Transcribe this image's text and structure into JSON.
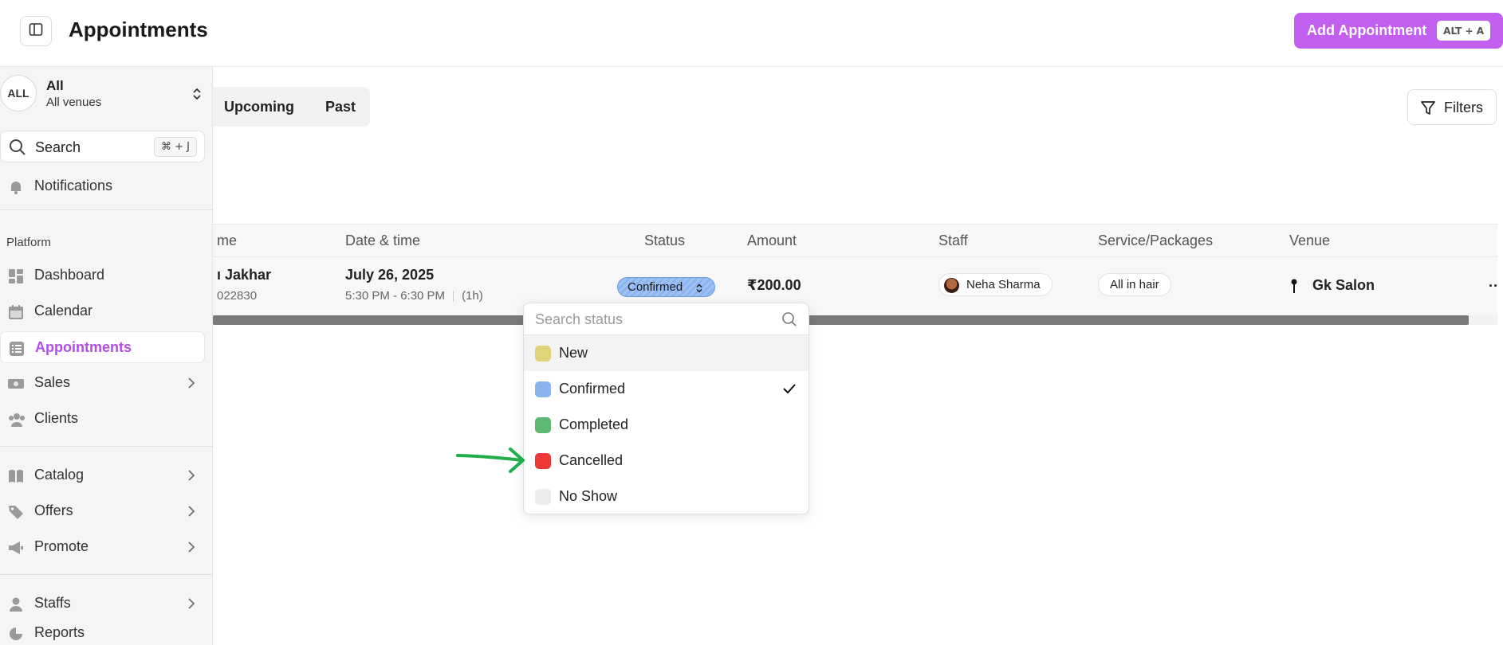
{
  "header": {
    "title": "Appointments",
    "add_button_label": "Add Appointment",
    "add_button_shortcut": "ALT + A",
    "accent_color": "#c25ef0"
  },
  "sidebar": {
    "venue": {
      "avatar": "ALL",
      "name": "All",
      "sub": "All venues"
    },
    "search": {
      "label": "Search",
      "shortcut": "⌘ + J"
    },
    "notifications": "Notifications",
    "section_label": "Platform",
    "items": [
      {
        "label": "Dashboard",
        "icon": "dashboard-icon"
      },
      {
        "label": "Calendar",
        "icon": "calendar-icon"
      },
      {
        "label": "Appointments",
        "icon": "list-icon",
        "active": true
      },
      {
        "label": "Sales",
        "icon": "money-icon",
        "has_children": true
      },
      {
        "label": "Clients",
        "icon": "users-icon"
      },
      {
        "label": "Catalog",
        "icon": "book-icon",
        "has_children": true
      },
      {
        "label": "Offers",
        "icon": "tag-icon",
        "has_children": true
      },
      {
        "label": "Promote",
        "icon": "megaphone-icon",
        "has_children": true
      },
      {
        "label": "Staffs",
        "icon": "staff-icon",
        "has_children": true
      },
      {
        "label": "Reports",
        "icon": "chart-icon"
      }
    ]
  },
  "tabs": [
    "Upcoming",
    "Past"
  ],
  "filters_label": "Filters",
  "table": {
    "columns": [
      "me",
      "Date & time",
      "Status",
      "Amount",
      "Staff",
      "Service/Packages",
      "Venue"
    ],
    "rows": [
      {
        "client_name": "ı Jakhar",
        "client_phone": "022830",
        "date": "July 26, 2025",
        "time": "5:30 PM - 6:30 PM",
        "duration": "(1h)",
        "status": "Confirmed",
        "amount": "₹200.00",
        "staff": "Neha Sharma",
        "service": "All in hair",
        "venue": "Gk Salon",
        "more": "··"
      }
    ]
  },
  "status_dropdown": {
    "placeholder": "Search status",
    "options": [
      {
        "label": "New",
        "color": "#e0d47a",
        "highlighted": true
      },
      {
        "label": "Confirmed",
        "color": "#8ab4f0",
        "selected": true
      },
      {
        "label": "Completed",
        "color": "#5db872"
      },
      {
        "label": "Cancelled",
        "color": "#ee3838"
      },
      {
        "label": "No Show",
        "color": "#ececec"
      }
    ]
  },
  "annotation_arrow_color": "#1fae4a"
}
